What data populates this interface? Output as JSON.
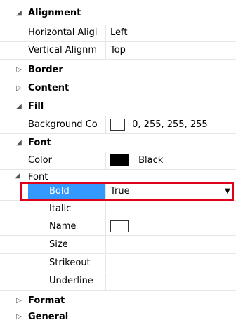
{
  "categories": {
    "alignment": "Alignment",
    "border": "Border",
    "content": "Content",
    "fill": "Fill",
    "font": "Font",
    "format": "Format",
    "general": "General"
  },
  "alignment": {
    "horizontal_name": "Horizontal Aligi",
    "horizontal_value": "Left",
    "vertical_name": "Vertical Alignm",
    "vertical_value": "Top"
  },
  "fill": {
    "background_name": "Background Co",
    "background_value": "0, 255, 255, 255"
  },
  "font": {
    "color_name": "Color",
    "color_value": "Black",
    "subgroup_label": "Font",
    "bold_name": "Bold",
    "bold_value": "True",
    "italic_name": "Italic",
    "name_name": "Name",
    "size_name": "Size",
    "strikeout_name": "Strikeout",
    "underline_name": "Underline"
  },
  "colors": {
    "selection": "#3399ff",
    "highlight_box": "#e0001b",
    "swatch_black": "#000000",
    "swatch_white": "#ffffff"
  },
  "icons": {
    "expanded": "triangle-down-icon",
    "collapsed": "triangle-right-icon",
    "dropdown": "chevron-down-icon"
  }
}
